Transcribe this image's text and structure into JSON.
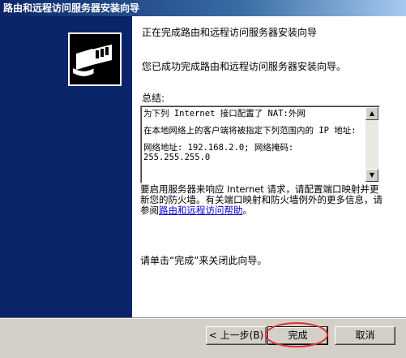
{
  "window": {
    "title": "路由和远程访问服务器安装向导"
  },
  "main": {
    "heading": "正在完成路由和远程访问服务器安装向导",
    "success_message": "您已成功完成路由和远程访问服务器安装向导。",
    "summary_label": "总结:",
    "summary_lines": [
      "为下列 Internet 接口配置了 NAT:外网",
      "在本地网络上的客户端将被指定下列范围内的 IP 地址:",
      "网络地址: 192.168.2.0; 网络掩码: 255.255.255.0"
    ],
    "info_text": "要启用服务器来响应 Internet 请求，请配置端口映射并更新您的防火墙。有关端口映射和防火墙例外的更多信息，请参阅",
    "help_link": "路由和远程访问帮助",
    "info_end": "。",
    "finish_hint": "请单击“完成”来关闭此向导。"
  },
  "buttons": {
    "back": "< 上一步(B)",
    "finish": "完成",
    "cancel": "取消"
  },
  "icons": {
    "logo": "network-cable-wizard-icon",
    "scroll_up": "scroll-up-arrow-icon",
    "scroll_down": "scroll-down-arrow-icon"
  },
  "colors": {
    "sidebar": "#0a246a",
    "highlight": "#e03030"
  }
}
